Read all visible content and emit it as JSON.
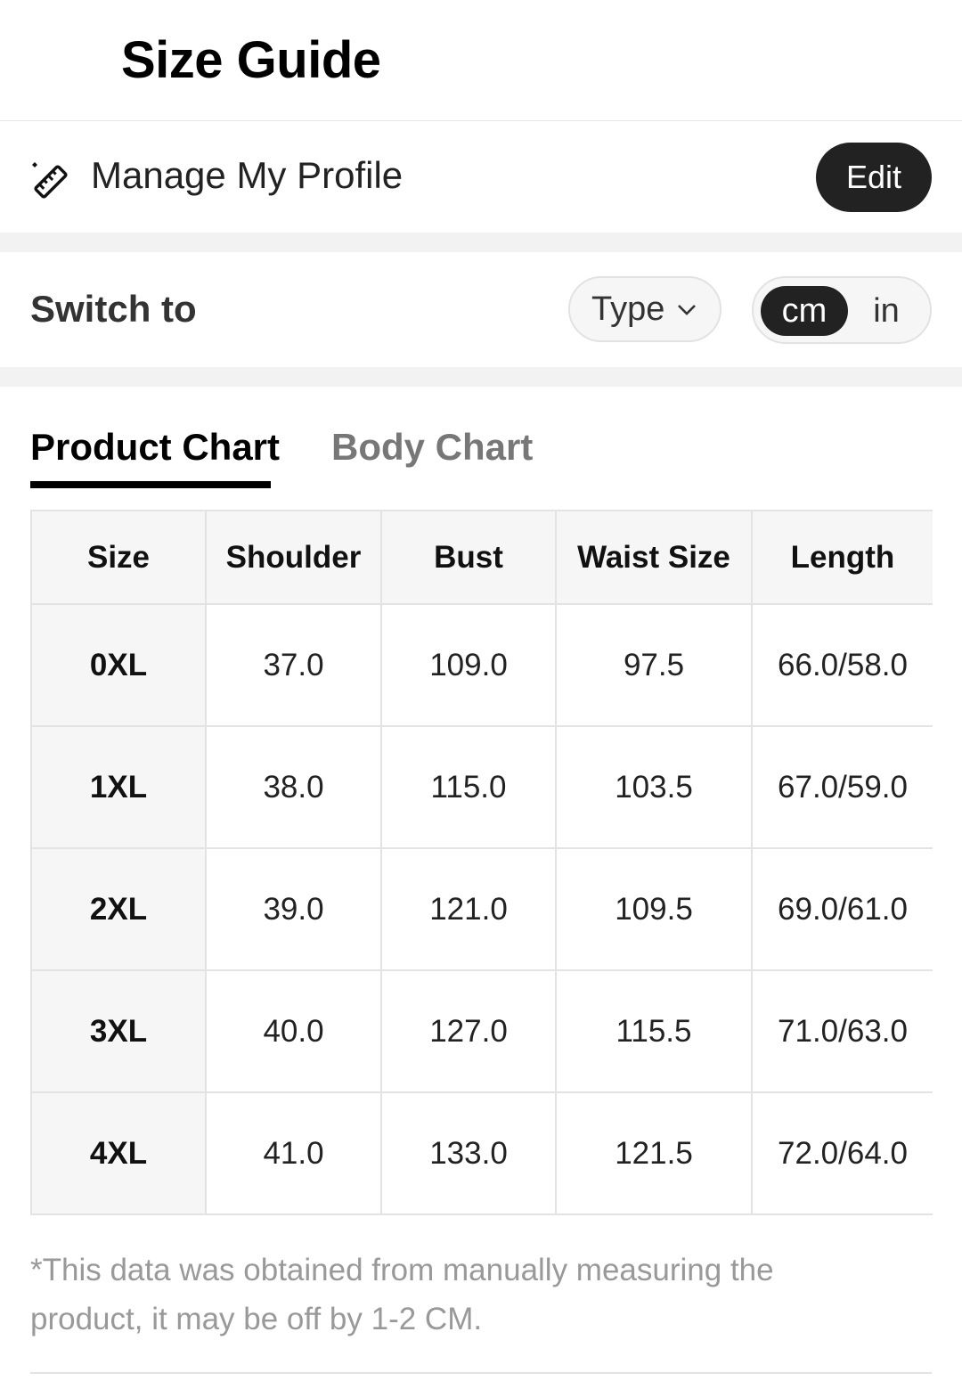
{
  "header": {
    "title": "Size Guide"
  },
  "profile": {
    "label": "Manage My Profile",
    "edit_label": "Edit"
  },
  "switch": {
    "label": "Switch to",
    "type_label": "Type",
    "units": [
      "cm",
      "in"
    ],
    "selected_unit": "cm"
  },
  "tabs": [
    {
      "label": "Product Chart",
      "active": true
    },
    {
      "label": "Body Chart",
      "active": false
    }
  ],
  "table": {
    "columns": [
      "Size",
      "Shoulder",
      "Bust",
      "Waist Size",
      "Length"
    ],
    "rows": [
      [
        "0XL",
        "37.0",
        "109.0",
        "97.5",
        "66.0/58.0"
      ],
      [
        "1XL",
        "38.0",
        "115.0",
        "103.5",
        "67.0/59.0"
      ],
      [
        "2XL",
        "39.0",
        "121.0",
        "109.5",
        "69.0/61.0"
      ],
      [
        "3XL",
        "40.0",
        "127.0",
        "115.5",
        "71.0/63.0"
      ],
      [
        "4XL",
        "41.0",
        "133.0",
        "121.5",
        "72.0/64.0"
      ]
    ]
  },
  "disclaimer": "*This data was obtained from manually measuring the product, it may be off by 1-2 CM.",
  "colors": {
    "accent": "#222222",
    "muted_text": "#999999",
    "band": "#f2f2f2",
    "border": "#e3e3e3"
  }
}
